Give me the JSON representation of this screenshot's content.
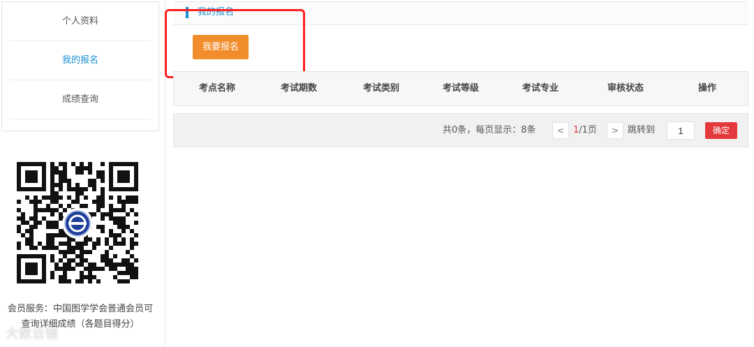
{
  "sidebar": {
    "items": [
      {
        "label": "个人资料",
        "active": false
      },
      {
        "label": "我的报名",
        "active": true
      },
      {
        "label": "成绩查询",
        "active": false
      }
    ],
    "service_text": "会员服务：中国图学学会普通会员可查询详细成绩（各题目得分）",
    "watermark": "大数云镜"
  },
  "header": {
    "title": "我的报名"
  },
  "register_button": {
    "label": "我要报名",
    "color": "#f28d2c"
  },
  "table": {
    "columns": [
      "考点名称",
      "考试期数",
      "考试类别",
      "考试等级",
      "考试专业",
      "审核状态",
      "操作"
    ],
    "rows": []
  },
  "pager": {
    "summary": "共0条，每页显示：8条",
    "prev": "<",
    "current_page": "1",
    "page_suffix": "/1页",
    "next": ">",
    "goto_label": "跳转到",
    "goto_value": "1",
    "confirm_label": "确定"
  },
  "colors": {
    "accent": "#1a8fd0",
    "primary_button": "#f28d2c",
    "confirm": "#e4393c",
    "highlight_box": "#ff1f1f"
  }
}
